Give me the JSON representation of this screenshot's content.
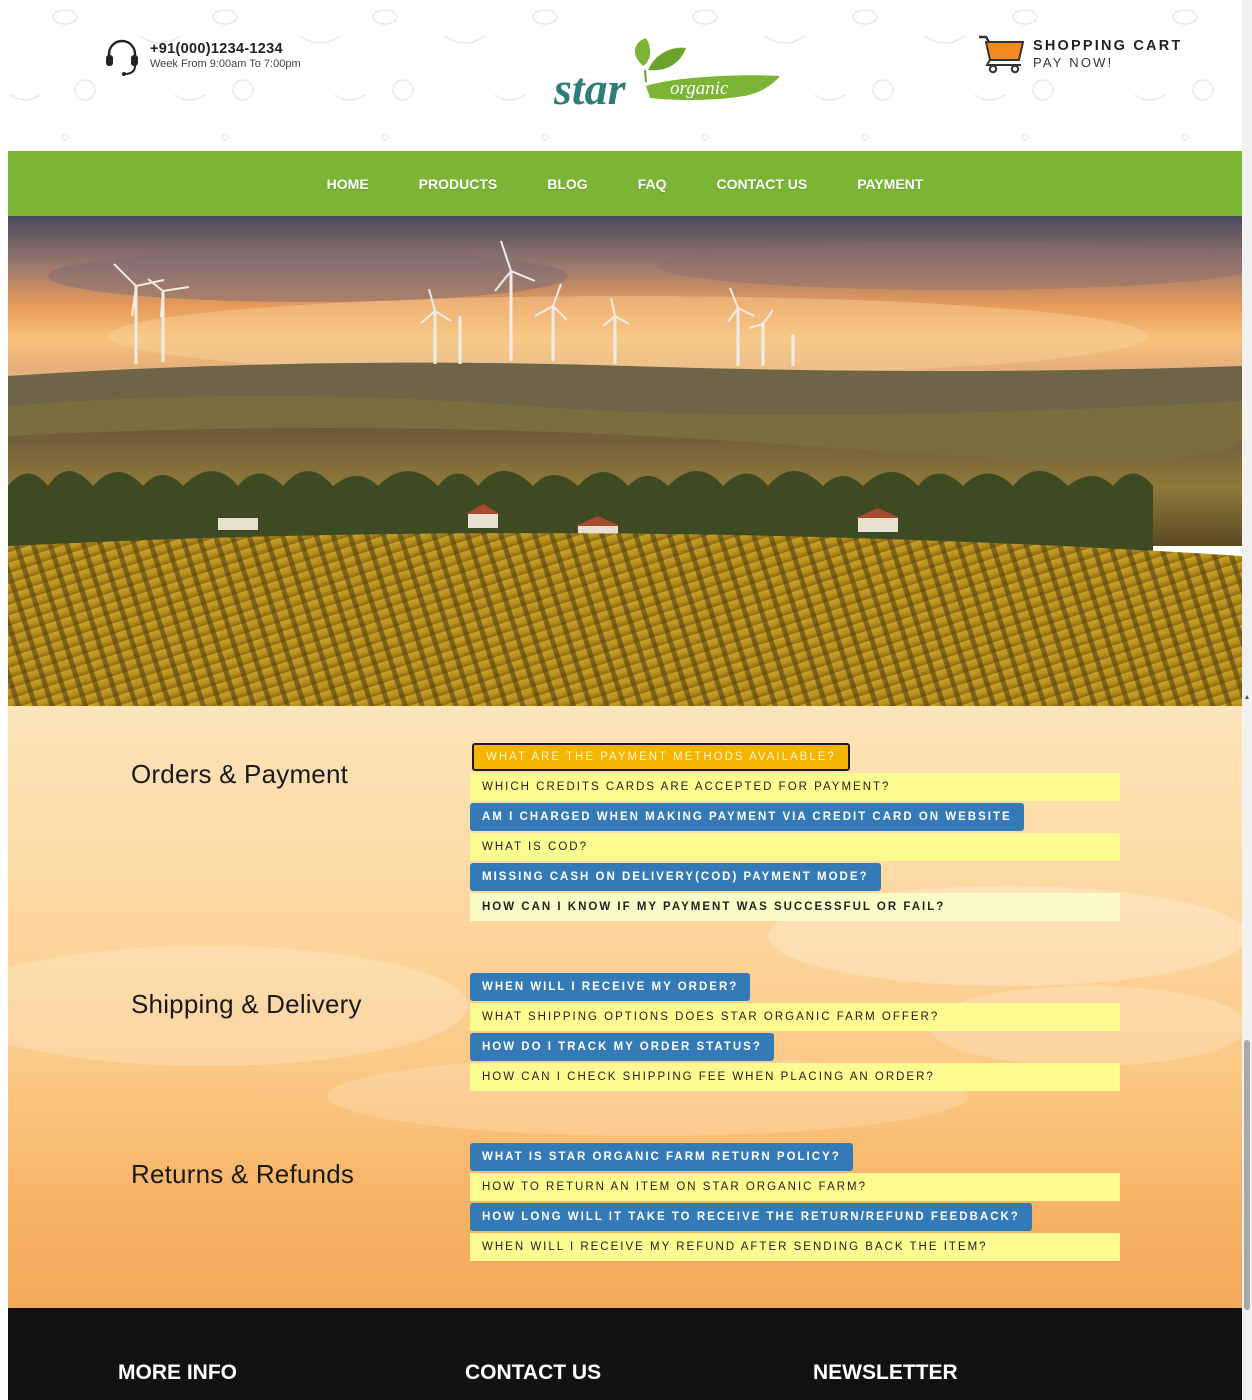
{
  "header": {
    "phone": "+91(000)1234-1234",
    "hours": "Week From 9:00am To 7:00pm",
    "logo_main": "star",
    "logo_leaf_text": "organic",
    "cart_title": "SHOPPING CART",
    "cart_sub": "PAY NOW!",
    "icons": [
      "headset-icon",
      "shopping-cart-icon"
    ]
  },
  "nav": {
    "items": [
      {
        "label": "HOME"
      },
      {
        "label": "PRODUCTS"
      },
      {
        "label": "BLOG"
      },
      {
        "label": "FAQ"
      },
      {
        "label": "CONTACT US"
      },
      {
        "label": "PAYMENT"
      }
    ],
    "color": "#7cb435"
  },
  "faq": {
    "sections": [
      {
        "title": "Orders & Payment",
        "questions": [
          {
            "text": "WHAT ARE THE PAYMENT METHODS AVAILABLE?",
            "style": "active"
          },
          {
            "text": "WHICH CREDITS CARDS ARE ACCEPTED FOR PAYMENT?",
            "style": "yellow"
          },
          {
            "text": "AM I CHARGED WHEN MAKING PAYMENT VIA CREDIT CARD ON WEBSITE",
            "style": "blue"
          },
          {
            "text": "WHAT IS COD?",
            "style": "yellow"
          },
          {
            "text": "MISSING CASH ON DELIVERY(COD) PAYMENT MODE?",
            "style": "blue"
          },
          {
            "text": "HOW CAN I KNOW IF MY PAYMENT WAS SUCCESSFUL OR FAIL?",
            "style": "yellow-bold"
          }
        ]
      },
      {
        "title": "Shipping & Delivery",
        "questions": [
          {
            "text": "WHEN WILL I RECEIVE MY ORDER?",
            "style": "blue"
          },
          {
            "text": "WHAT SHIPPING OPTIONS DOES STAR ORGANIC FARM OFFER?",
            "style": "yellow"
          },
          {
            "text": "HOW DO I TRACK MY ORDER STATUS?",
            "style": "blue"
          },
          {
            "text": "HOW CAN I CHECK SHIPPING FEE WHEN PLACING AN ORDER?",
            "style": "yellow"
          }
        ]
      },
      {
        "title": "Returns & Refunds",
        "questions": [
          {
            "text": "WHAT IS STAR ORGANIC FARM RETURN POLICY?",
            "style": "blue"
          },
          {
            "text": "HOW TO RETURN AN ITEM ON STAR ORGANIC FARM?",
            "style": "yellow"
          },
          {
            "text": "HOW LONG WILL IT TAKE TO RECEIVE THE RETURN/REFUND FEEDBACK?",
            "style": "blue"
          },
          {
            "text": "WHEN WILL I RECEIVE MY REFUND AFTER SENDING BACK THE ITEM?",
            "style": "yellow"
          }
        ]
      }
    ],
    "colors": {
      "blue": "#337ab7",
      "yellow": "#fbfb8f",
      "active": "#f5b400"
    }
  },
  "footer": {
    "headings": [
      "MORE INFO",
      "CONTACT US",
      "NEWSLETTER"
    ]
  }
}
